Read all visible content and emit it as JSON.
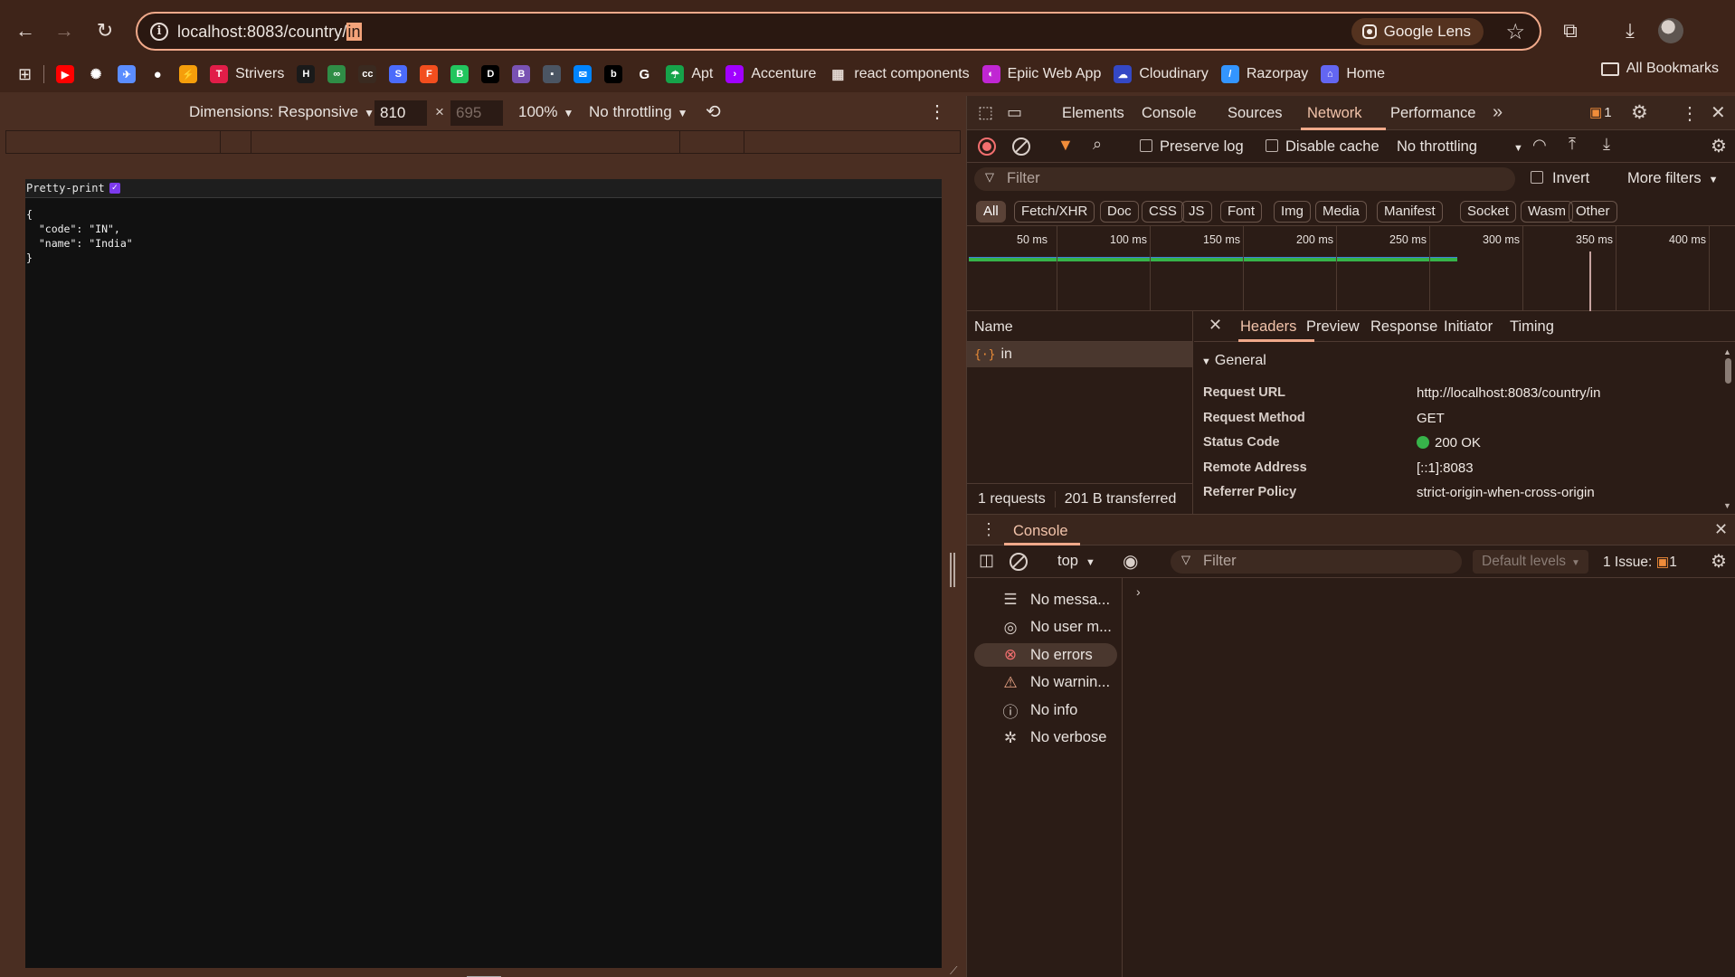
{
  "browser": {
    "url_prefix": "localhost:8083/country/",
    "url_selected": "in",
    "lens_label": "Google Lens"
  },
  "bookmarks": {
    "items": [
      {
        "label": "",
        "icon": "youtube-icon",
        "color": "#ff0000"
      },
      {
        "label": "",
        "icon": "openai-icon",
        "color": "#ffffff"
      },
      {
        "label": "",
        "icon": "bird-icon",
        "color": "#5b8dff"
      },
      {
        "label": "",
        "icon": "github-icon",
        "color": "#ffffff"
      },
      {
        "label": "",
        "icon": "lightning-icon",
        "color": "#f59e0b"
      },
      {
        "label": "Strivers",
        "icon": "tuf-icon",
        "color": "#e11d48"
      },
      {
        "label": "",
        "icon": "hackerrank-icon",
        "color": "#1a1a1a"
      },
      {
        "label": "",
        "icon": "gfg-icon",
        "color": "#2f8d46"
      },
      {
        "label": "",
        "icon": "cc-icon",
        "color": "#3a2a20"
      },
      {
        "label": "",
        "icon": "s-icon",
        "color": "#4b6bfb"
      },
      {
        "label": "",
        "icon": "figma-icon",
        "color": "#f24e1e"
      },
      {
        "label": "",
        "icon": "green-b-icon",
        "color": "#22c55e"
      },
      {
        "label": "",
        "icon": "dev-icon",
        "color": "#000000"
      },
      {
        "label": "",
        "icon": "bootstrap-icon",
        "color": "#7952b3"
      },
      {
        "label": "",
        "icon": "square-icon",
        "color": "#4b5563"
      },
      {
        "label": "",
        "icon": "messenger-icon",
        "color": "#0084ff"
      },
      {
        "label": "",
        "icon": "b-black-icon",
        "color": "#000000"
      },
      {
        "label": "",
        "icon": "google-icon",
        "color": "#ffffff"
      },
      {
        "label": "Apt",
        "icon": "apt-icon",
        "color": "#16a34a"
      },
      {
        "label": "Accenture",
        "icon": "accenture-icon",
        "color": "#a100ff"
      },
      {
        "label": "react components",
        "icon": "grid-icon",
        "color": "#e6dcd6"
      },
      {
        "label": "Epiic Web App",
        "icon": "epic-icon",
        "color": "#c026d3"
      },
      {
        "label": "Cloudinary",
        "icon": "cloudinary-icon",
        "color": "#3448c5"
      },
      {
        "label": "Razorpay",
        "icon": "razorpay-icon",
        "color": "#3395ff"
      },
      {
        "label": "Home",
        "icon": "home-icon",
        "color": "#6366f1"
      }
    ],
    "all_label": "All Bookmarks"
  },
  "device_toolbar": {
    "dimensions_label": "Dimensions: Responsive",
    "width": "810",
    "height": "695",
    "zoom": "100%",
    "throttling": "No throttling"
  },
  "viewport": {
    "pretty_print_label": "Pretty-print",
    "json_text": "{\n  \"code\": \"IN\",\n  \"name\": \"India\"\n}"
  },
  "devtools": {
    "tabs": [
      "Elements",
      "Console",
      "Sources",
      "Network",
      "Performance"
    ],
    "active_tab": "Network",
    "issues_count": "1",
    "network": {
      "preserve_log": "Preserve log",
      "disable_cache": "Disable cache",
      "throttling": "No throttling",
      "filter_placeholder": "Filter",
      "invert": "Invert",
      "more_filters": "More filters",
      "types": [
        "All",
        "Fetch/XHR",
        "Doc",
        "CSS",
        "JS",
        "Font",
        "Img",
        "Media",
        "Manifest",
        "Socket",
        "Wasm",
        "Other"
      ],
      "timeline_labels": [
        "50 ms",
        "100 ms",
        "150 ms",
        "200 ms",
        "250 ms",
        "300 ms",
        "350 ms",
        "400 ms"
      ],
      "name_header": "Name",
      "request_name": "in",
      "requests_count": "1 requests",
      "transferred": "201 B transferred"
    },
    "details": {
      "tabs": [
        "Headers",
        "Preview",
        "Response",
        "Initiator",
        "Timing"
      ],
      "general_label": "General",
      "rows": [
        {
          "key": "Request URL",
          "value": "http://localhost:8083/country/in"
        },
        {
          "key": "Request Method",
          "value": "GET"
        },
        {
          "key": "Status Code",
          "value": "200 OK"
        },
        {
          "key": "Remote Address",
          "value": "[::1]:8083"
        },
        {
          "key": "Referrer Policy",
          "value": "strict-origin-when-cross-origin"
        }
      ]
    },
    "console": {
      "tab_label": "Console",
      "context": "top",
      "filter_placeholder": "Filter",
      "levels": "Default levels",
      "issues_label": "1 Issue:",
      "issues_count": "1",
      "sidebar": [
        {
          "label": "No messa...",
          "icon": "list-icon"
        },
        {
          "label": "No user m...",
          "icon": "user-icon"
        },
        {
          "label": "No errors",
          "icon": "error-icon"
        },
        {
          "label": "No warnin...",
          "icon": "warning-icon"
        },
        {
          "label": "No info",
          "icon": "info-icon"
        },
        {
          "label": "No verbose",
          "icon": "bug-icon"
        }
      ]
    }
  }
}
